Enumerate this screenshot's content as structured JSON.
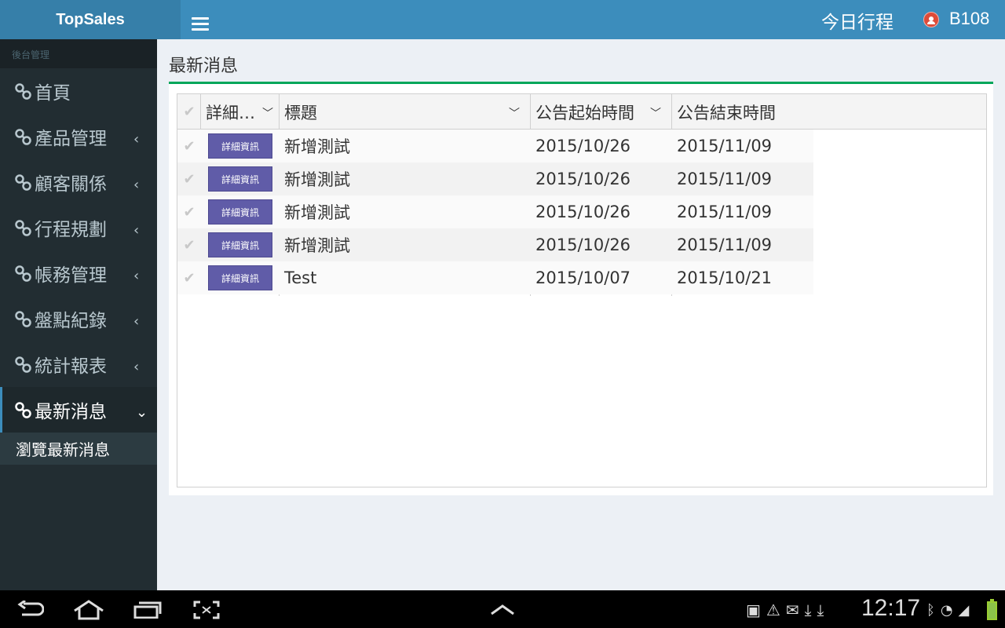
{
  "app": {
    "brand": "TopSales"
  },
  "header": {
    "today_label": "今日行程",
    "user": "B108"
  },
  "sidebar": {
    "section_label": "後台管理",
    "items": [
      {
        "label": "首頁",
        "has_chevron": false
      },
      {
        "label": "產品管理",
        "chevron": "‹"
      },
      {
        "label": "顧客關係",
        "chevron": "‹"
      },
      {
        "label": "行程規劃",
        "chevron": "‹"
      },
      {
        "label": "帳務管理",
        "chevron": "‹"
      },
      {
        "label": "盤點紀錄",
        "chevron": "‹"
      },
      {
        "label": "統計報表",
        "chevron": "‹"
      },
      {
        "label": "最新消息",
        "chevron": "⌄",
        "active": true
      }
    ],
    "submenu": {
      "label": "瀏覽最新消息"
    }
  },
  "main": {
    "page_title": "最新消息",
    "grid": {
      "columns": [
        "詳細…",
        "標題",
        "公告起始時間",
        "公告結束時間"
      ],
      "detail_button_label": "詳細資訊",
      "rows": [
        {
          "title": "新增測試",
          "start": "2015/10/26",
          "end": "2015/11/09"
        },
        {
          "title": "新增測試",
          "start": "2015/10/26",
          "end": "2015/11/09"
        },
        {
          "title": "新增測試",
          "start": "2015/10/26",
          "end": "2015/11/09"
        },
        {
          "title": "新增測試",
          "start": "2015/10/26",
          "end": "2015/11/09"
        },
        {
          "title": "Test",
          "start": "2015/10/07",
          "end": "2015/10/21"
        }
      ]
    }
  },
  "system_bar": {
    "clock": "12:17"
  },
  "colors": {
    "topbar": "#3c8dbc",
    "brand_bg": "#367fa9",
    "sidebar": "#222d32",
    "accent_green": "#00a65a",
    "detail_button": "#605ca8"
  }
}
